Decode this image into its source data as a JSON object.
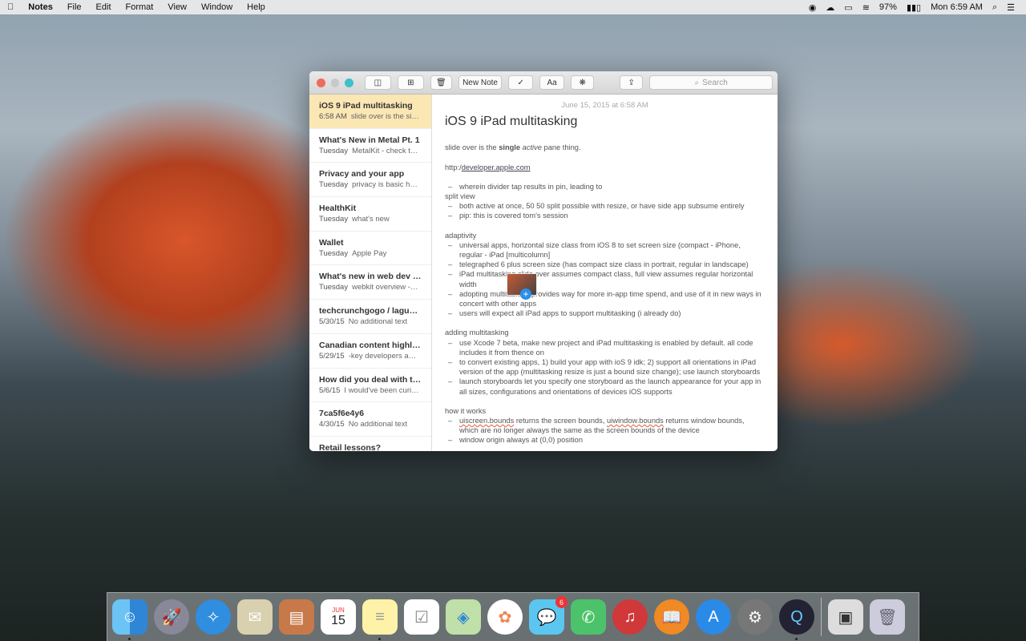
{
  "menubar": {
    "app": "Notes",
    "menus": [
      "File",
      "Edit",
      "Format",
      "View",
      "Window",
      "Help"
    ],
    "battery": "97%",
    "clock": "Mon 6:59 AM"
  },
  "toolbar": {
    "new_note": "New Note",
    "format": "Aa",
    "search_placeholder": "Search"
  },
  "notes_list": [
    {
      "title": "iOS 9 iPad multitasking",
      "date": "6:58 AM",
      "preview": "slide over is the si…"
    },
    {
      "title": "What's New in Metal Pt. 1",
      "date": "Tuesday",
      "preview": "MetalKit - check t…"
    },
    {
      "title": "Privacy and your app",
      "date": "Tuesday",
      "preview": "privacy is basic h…"
    },
    {
      "title": "HealthKit",
      "date": "Tuesday",
      "preview": "what's new"
    },
    {
      "title": "Wallet",
      "date": "Tuesday",
      "preview": "Apple Pay"
    },
    {
      "title": "What's new in web dev i…",
      "date": "Tuesday",
      "preview": "webkit overview -…"
    },
    {
      "title": "techcrunchgogo / lagun…",
      "date": "5/30/15",
      "preview": "No additional text"
    },
    {
      "title": "Canadian content highl…",
      "date": "5/29/15",
      "preview": "-key developers a…"
    },
    {
      "title": "How did you deal with t…",
      "date": "5/6/15",
      "preview": "I would've been curi…"
    },
    {
      "title": "7ca5f6e4y6",
      "date": "4/30/15",
      "preview": "No additional text"
    },
    {
      "title": "Retail lessons?",
      "date": "",
      "preview": ""
    }
  ],
  "note": {
    "date": "June 15, 2015 at 6:58 AM",
    "title": "iOS 9 iPad multitasking",
    "intro_a": "slide over is the ",
    "intro_b": "single",
    "intro_c": "active",
    "intro_d": " pane thing.",
    "url_a": "http:/",
    "url_b": "developer.apple.com",
    "l1": "wherein divider tap results in pin, leading to",
    "l2": "split view",
    "l3": "both active at once, 50 50 split possible with resize, or have side app subsume entirely",
    "l4": "pip: this is covered tom's session",
    "h_adapt": "adaptivity",
    "a1": "universal apps, horizontal size class from iOS 8 to set screen size (compact - iPhone, regular - iPad [multicolumn]",
    "a2": "telegraphed 6 plus screen size (has compact size class in portrait, regular in landscape)",
    "a3": "iPad multitasking slide over assumes compact class, full view assumes regular horizontal width",
    "a4": "adopting multitasking provides way for more in-app time spend, and use of it in new ways in concert with other apps",
    "a5": "users will expect all iPad apps to support multitasking (i already do)",
    "h_add": "adding multitasking",
    "m1": "use Xcode 7 beta, make new project and iPad multitasking is enabled by default. all code includes it from thence on",
    "m2": "to convert existing apps, 1) build your app with ioS 9 idk; 2) support all orientations in iPad version of the app (multitasking resize is just a bound size change); use launch storyboards",
    "m3": "launch storyboards let you specify one storyboard as the launch appearance for your app in all sizes, configurations and orientations of devices iOS supports",
    "h_how": "how it works",
    "w1a": "uiscreen.bounds",
    "w1b": " returns the screen bounds, ",
    "w1c": "uiwindow.bounds",
    "w1d": " returns window bounds, which are no longer always the same as the screen bounds of the device",
    "w2": "window origin always at (0,0) position"
  },
  "dock": {
    "calendar_month": "JUN",
    "calendar_day": "15",
    "messages_badge": "6"
  }
}
